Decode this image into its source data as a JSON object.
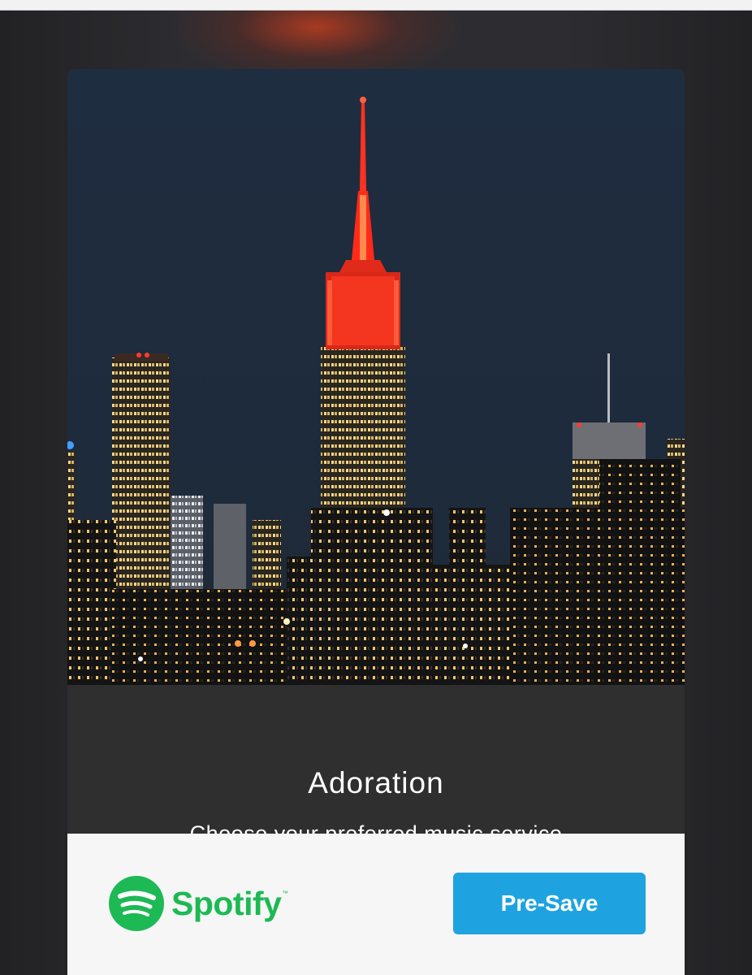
{
  "release": {
    "title": "Adoration",
    "subtitle": "Choose your preferred music service",
    "artwork_icon": "city-skyline-night-image"
  },
  "services": [
    {
      "name": "Spotify",
      "icon": "spotify-logo-icon",
      "brand_color": "#1db954",
      "action_label": "Pre-Save",
      "action_color": "#1ea3e0"
    }
  ],
  "colors": {
    "page_background": "#2c2c2f",
    "info_panel": "#2f2f2f",
    "service_row": "#f6f6f6",
    "glow": "#be3c1e"
  }
}
